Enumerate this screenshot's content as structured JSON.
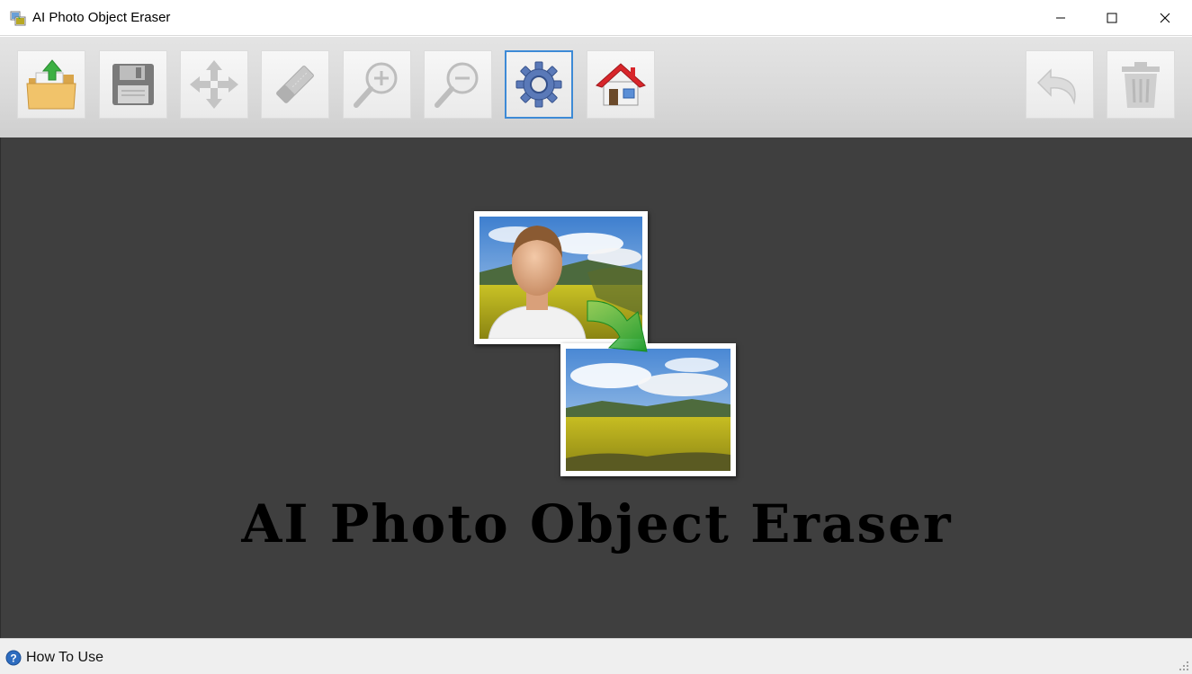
{
  "window": {
    "title": "AI Photo Object Eraser",
    "controls": [
      "minimize",
      "maximize",
      "close"
    ]
  },
  "toolbar": {
    "buttons": [
      {
        "icon": "open-folder-icon",
        "enabled": true
      },
      {
        "icon": "save-disk-icon",
        "enabled": false
      },
      {
        "icon": "move-arrows-icon",
        "enabled": false
      },
      {
        "icon": "eraser-icon",
        "enabled": false
      },
      {
        "icon": "zoom-in-icon",
        "enabled": false
      },
      {
        "icon": "zoom-out-icon",
        "enabled": false
      },
      {
        "icon": "gear-icon",
        "enabled": true,
        "active": true
      },
      {
        "icon": "home-icon",
        "enabled": true
      },
      {
        "icon": "undo-icon",
        "enabled": false
      },
      {
        "icon": "trash-icon",
        "enabled": false
      }
    ]
  },
  "canvas": {
    "background": "#3f3f3f",
    "logo_text": "AI Photo Object Eraser"
  },
  "statusbar": {
    "how_to_use": "How To Use",
    "icon": "help-icon"
  },
  "colors": {
    "accent": "#3d8ad6",
    "toolbar_bg": "#dcdcdc",
    "canvas_bg": "#3f3f3f"
  }
}
